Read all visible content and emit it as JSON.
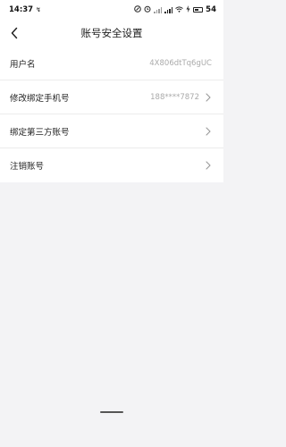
{
  "status_bar": {
    "time": "14:37",
    "notification_glyph": "↯",
    "icons": [
      "nfc-icon",
      "alarm-icon",
      "signal-icon",
      "signal-icon",
      "wifi-icon",
      "battery-icon"
    ],
    "battery_level": "54"
  },
  "nav": {
    "title": "账号安全设置"
  },
  "settings": {
    "items": [
      {
        "label": "用户名",
        "value": "4X806dtTq6gUC"
      },
      {
        "label": "修改绑定手机号",
        "value": "188****7872"
      },
      {
        "label": "绑定第三方账号",
        "value": ""
      },
      {
        "label": "注销账号",
        "value": ""
      }
    ]
  },
  "colors": {
    "background": "#f3f3f5",
    "row_background": "#ffffff",
    "secondary_text": "#aaaaaa",
    "divider": "#ececec"
  }
}
